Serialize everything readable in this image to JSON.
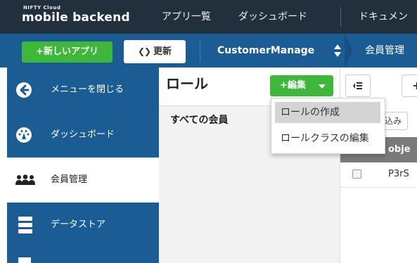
{
  "header": {
    "logo_small": "NIFTY Cloud",
    "logo_main": "mobile backend",
    "nav": [
      "アプリ一覧",
      "ダッシュボード",
      "ドキュメン"
    ]
  },
  "toolbar": {
    "new_app_label": "+新しいアプリ",
    "refresh_label": "更新",
    "app_name": "CustomerManage",
    "breadcrumb": "会員管理"
  },
  "sidebar": {
    "items": [
      {
        "label": "メニューを閉じる",
        "icon": "arrow-left-circle-icon"
      },
      {
        "label": "ダッシュボード",
        "icon": "speedometer-icon"
      },
      {
        "label": "会員管理",
        "icon": "users-icon",
        "active": true
      },
      {
        "label": "データストア",
        "icon": "database-icon"
      }
    ]
  },
  "role_panel": {
    "title": "ロール",
    "edit_label": "+編集",
    "all_members": "すべての会員"
  },
  "main": {
    "add_label": "+",
    "filter_label": "込み",
    "column_header": "obje",
    "row_value": "P3rS"
  },
  "dropdown": {
    "items": [
      "ロールの作成",
      "ロールクラスの編集"
    ]
  },
  "colors": {
    "topbar": "#222f3d",
    "primary_blue": "#1c5c94",
    "accent_green": "#3eb83a"
  }
}
